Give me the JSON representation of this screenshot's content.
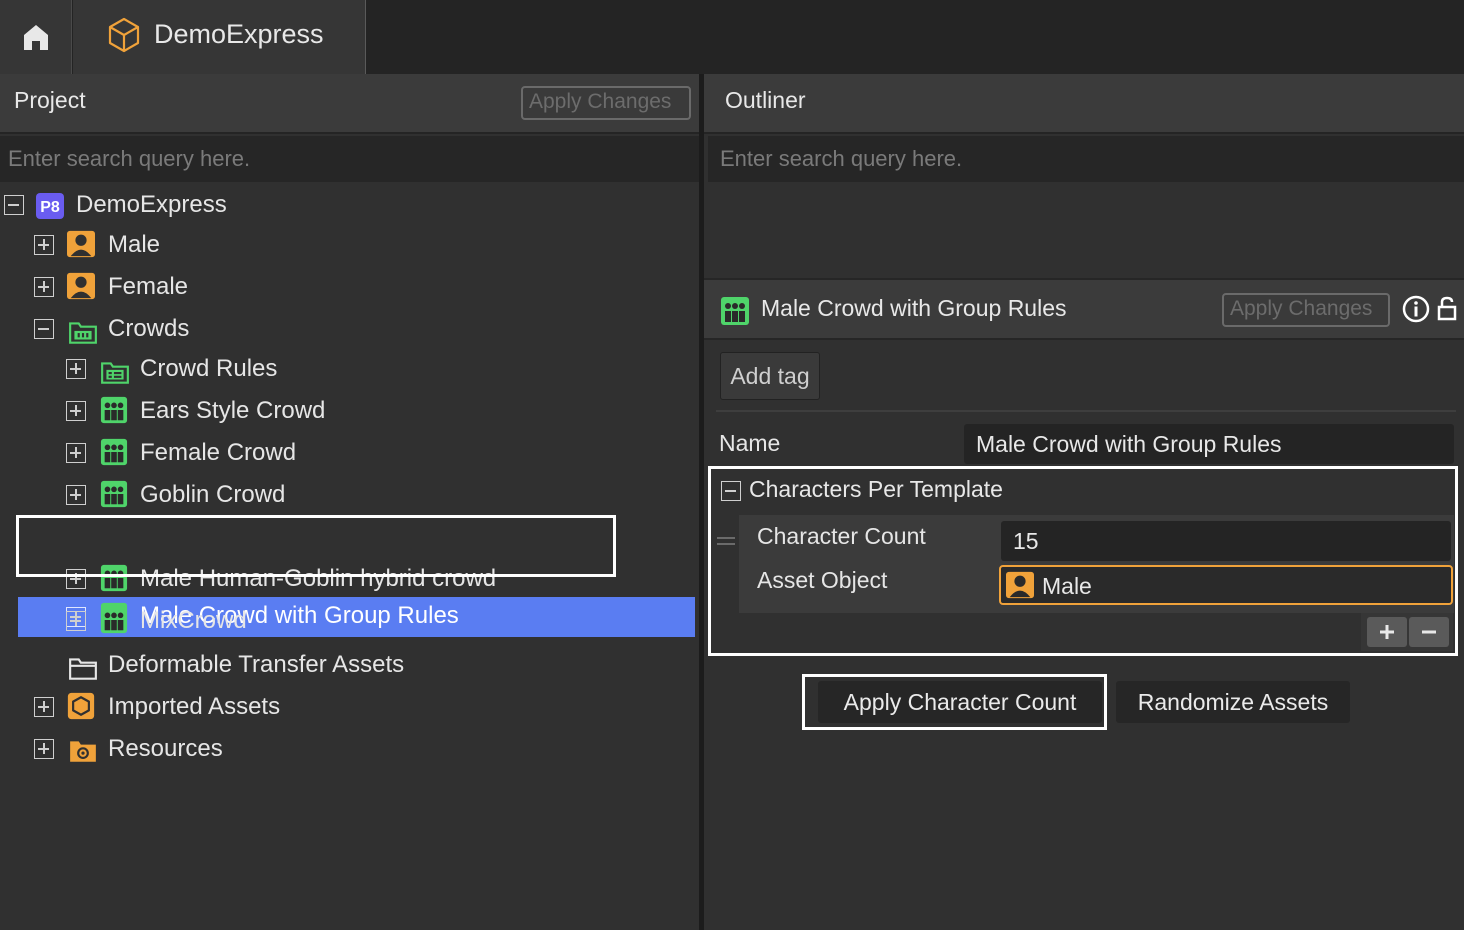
{
  "topbar": {
    "home_icon": "home-icon",
    "project_tab_icon": "cube-icon",
    "project_tab_label": "DemoExpress"
  },
  "left_panel": {
    "title": "Project",
    "apply_changes_label": "Apply Changes",
    "search_placeholder": "Enter search query here.",
    "tree": [
      {
        "label": "DemoExpress",
        "icon": "p8-project-icon",
        "expander": "minus"
      },
      {
        "label": "Male",
        "icon": "character-icon",
        "expander": "plus"
      },
      {
        "label": "Female",
        "icon": "character-icon",
        "expander": "plus"
      },
      {
        "label": "Crowds",
        "icon": "crowd-folder-icon",
        "expander": "minus"
      },
      {
        "label": "Crowd Rules",
        "icon": "crowd-rules-icon",
        "expander": "plus"
      },
      {
        "label": "Ears Style Crowd",
        "icon": "crowd-icon",
        "expander": "plus"
      },
      {
        "label": "Female Crowd",
        "icon": "crowd-icon",
        "expander": "plus"
      },
      {
        "label": "Goblin Crowd",
        "icon": "crowd-icon",
        "expander": "plus"
      },
      {
        "label": "Male Crowd with Group Rules",
        "icon": "crowd-icon",
        "expander": "plus",
        "selected": true
      },
      {
        "label": "Male Human-Goblin hybrid crowd",
        "icon": "crowd-icon",
        "expander": "plus"
      },
      {
        "label": "MixCrowd",
        "icon": "crowd-icon",
        "expander": "plus"
      },
      {
        "label": "Deformable Transfer Assets",
        "icon": "folder-icon",
        "expander": "none"
      },
      {
        "label": "Imported Assets",
        "icon": "imported-assets-icon",
        "expander": "plus"
      },
      {
        "label": "Resources",
        "icon": "resources-folder-icon",
        "expander": "plus"
      }
    ]
  },
  "right_panel": {
    "title": "Outliner",
    "search_placeholder": "Enter search query here.",
    "properties": {
      "title": "Male Crowd with Group Rules",
      "apply_changes_label": "Apply Changes",
      "add_tag_label": "Add tag",
      "name_label": "Name",
      "name_value": "Male Crowd with Group Rules",
      "section_label": "Characters Per Template",
      "character_count_label": "Character Count",
      "character_count_value": "15",
      "asset_object_label": "Asset Object",
      "asset_object_value": "Male",
      "apply_character_count_label": "Apply Character Count",
      "randomize_assets_label": "Randomize Assets"
    }
  },
  "colors": {
    "selection": "#5a7df2",
    "crowd_green": "#4fd46a",
    "character_orange": "#f0a23a",
    "p8_purple": "#6a5cf0"
  }
}
